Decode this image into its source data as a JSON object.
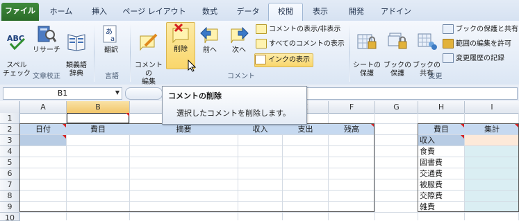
{
  "tabs": [
    "ファイル",
    "ホーム",
    "挿入",
    "ページ レイアウト",
    "数式",
    "データ",
    "校閲",
    "表示",
    "開発",
    "アドイン"
  ],
  "ribbon": {
    "proofing": {
      "spell": "スペル\nチェック",
      "research": "リサーチ",
      "thesaurus": "類義語\n辞典",
      "group": "文章校正"
    },
    "language": {
      "translate": "翻訳",
      "group": "言語"
    },
    "comments": {
      "new": "コメントの\n編集",
      "delete": "削除",
      "prev": "前へ",
      "next": "次へ",
      "show_hide": "コメントの表示/非表示",
      "show_all": "すべてのコメントの表示",
      "ink": "インクの表示",
      "group": "コメント"
    },
    "changes": {
      "protect_sheet": "シートの\n保護",
      "protect_book": "ブックの\n保護",
      "share_book": "ブックの\n共有",
      "protect_share": "ブックの保護と共有",
      "allow_edit": "範囲の編集を許可",
      "track": "変更履歴の記録",
      "group": "変更"
    }
  },
  "formula_bar": {
    "name_box": "B1"
  },
  "tooltip": {
    "title": "コメントの削除",
    "body": "選択したコメントを削除します。"
  },
  "columns": [
    "A",
    "B",
    "C",
    "D",
    "E",
    "F",
    "G",
    "H",
    "I"
  ],
  "rows": [
    "1",
    "2",
    "3",
    "4",
    "5",
    "6",
    "7",
    "8",
    "9",
    "10"
  ],
  "ledger_headers": {
    "date": "日付",
    "item": "費目",
    "memo": "摘要",
    "income": "収入",
    "expense": "支出",
    "balance": "残高"
  },
  "summary": {
    "header_item": "費目",
    "header_total": "集計",
    "items": [
      "収入",
      "食費",
      "図書費",
      "交通費",
      "被服費",
      "交際費",
      "雑費"
    ]
  },
  "colors": {
    "header_fill": "#c6d9f0",
    "income_row": "#b8cce4",
    "total_fill": "#daeef3",
    "selected_peach": "#fde9d9",
    "accent": "#2a6b28"
  }
}
